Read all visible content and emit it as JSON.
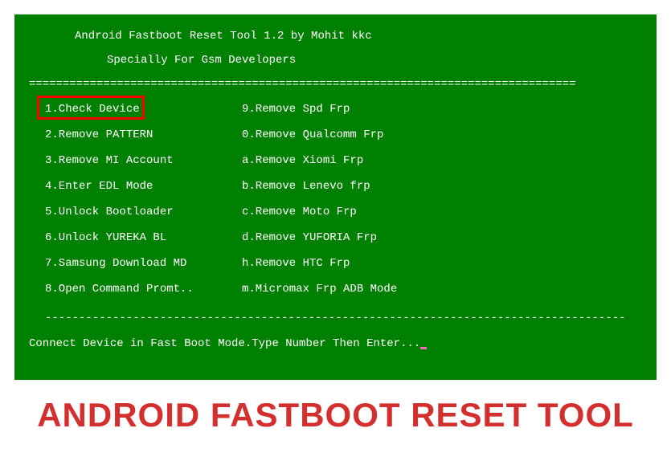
{
  "terminal": {
    "title": "Android Fastboot Reset Tool 1.2 by Mohit kkc",
    "subtitle": "Specially For Gsm Developers",
    "divider_equals": "=================================================================================",
    "divider_dashes": "--------------------------------------------------------------------------------------",
    "menu": {
      "left": [
        "1.Check Device",
        "2.Remove PATTERN",
        "3.Remove MI Account",
        "4.Enter EDL Mode",
        "5.Unlock Bootloader",
        "6.Unlock YUREKA BL",
        "7.Samsung Download MD",
        "8.Open Command Promt.."
      ],
      "right": [
        "9.Remove Spd Frp",
        "0.Remove Qualcomm Frp",
        "a.Remove Xiomi Frp",
        "b.Remove Lenevo frp",
        "c.Remove Moto Frp",
        "d.Remove YUFORIA Frp",
        "h.Remove HTC Frp",
        "m.Micromax Frp ADB Mode"
      ]
    },
    "prompt": "Connect Device in Fast Boot Mode.Type Number Then Enter..."
  },
  "caption": "ANDROID FASTBOOT RESET TOOL"
}
